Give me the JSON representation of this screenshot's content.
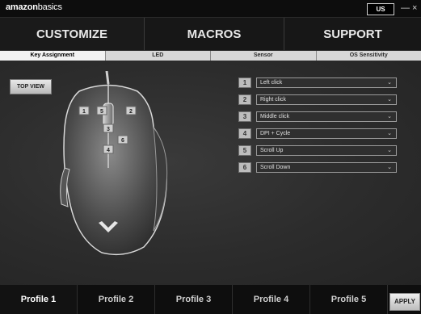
{
  "titlebar": {
    "brand_bold": "amazon",
    "brand_light": "basics",
    "region": "US",
    "minimize": "—",
    "close": "×"
  },
  "mainnav": {
    "tabs": [
      "CUSTOMIZE",
      "MACROS",
      "SUPPORT"
    ]
  },
  "subnav": {
    "tabs": [
      "Key Assignment",
      "LED",
      "Sensor",
      "OS Sensitivity"
    ]
  },
  "content": {
    "view_button": "TOP VIEW",
    "bindings": [
      {
        "number": "1",
        "action": "Left click"
      },
      {
        "number": "2",
        "action": "Right click"
      },
      {
        "number": "3",
        "action": "Middle click"
      },
      {
        "number": "4",
        "action": "DPI + Cycle"
      },
      {
        "number": "5",
        "action": "Scroll Up"
      },
      {
        "number": "6",
        "action": "Scroll Down"
      }
    ],
    "mouse_labels": [
      "1",
      "5",
      "2",
      "3",
      "6",
      "4"
    ]
  },
  "profiles": {
    "tabs": [
      "Profile 1",
      "Profile 2",
      "Profile 3",
      "Profile 4",
      "Profile 5"
    ],
    "apply": "APPLY"
  },
  "colors": {
    "background": "#2a2a2a",
    "nav": "#171717",
    "subnav": "#d7d7d7"
  }
}
